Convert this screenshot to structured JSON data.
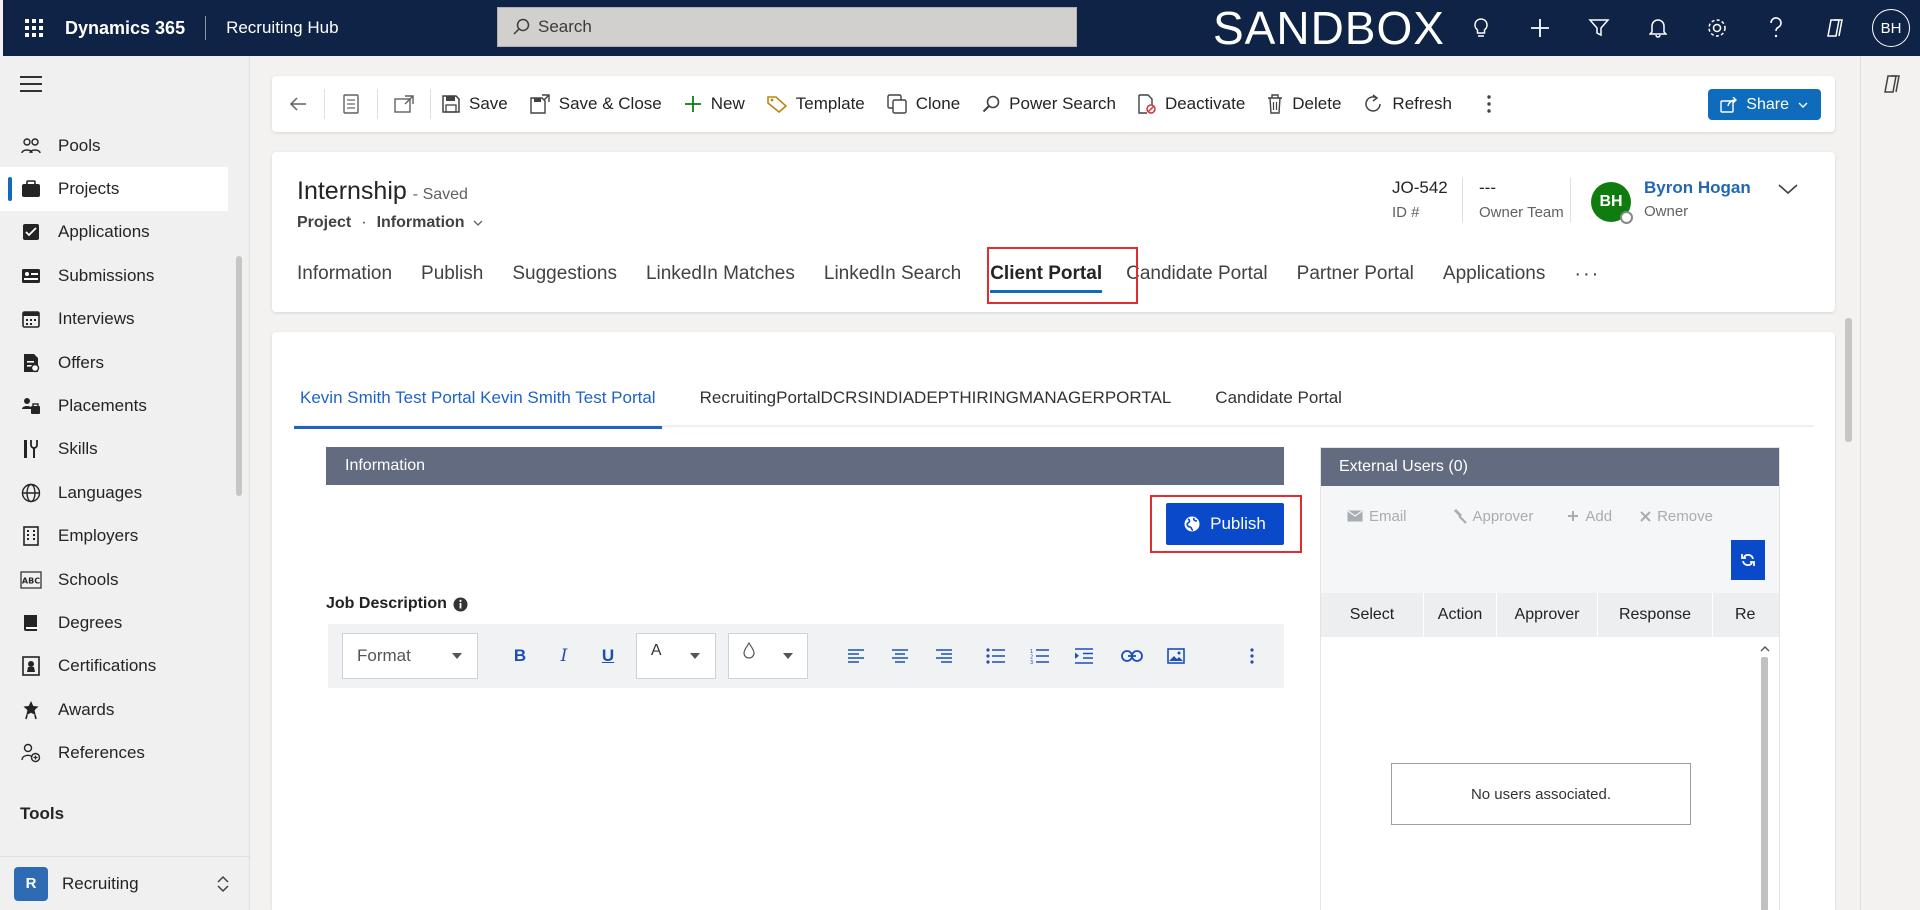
{
  "topbar": {
    "brand": "Dynamics 365",
    "app_name": "Recruiting Hub",
    "search_placeholder": "Search",
    "environment": "SANDBOX",
    "user_initials": "BH",
    "icons": [
      "lightbulb-icon",
      "plus-icon",
      "filter-icon",
      "bell-icon",
      "gear-icon",
      "help-icon",
      "copilot-icon"
    ]
  },
  "sidebar": {
    "items": [
      {
        "label": "Pools",
        "icon": "pools-icon"
      },
      {
        "label": "Projects",
        "icon": "briefcase-icon",
        "active": true
      },
      {
        "label": "Applications",
        "icon": "applications-icon"
      },
      {
        "label": "Submissions",
        "icon": "submissions-icon"
      },
      {
        "label": "Interviews",
        "icon": "calendar-icon"
      },
      {
        "label": "Offers",
        "icon": "offers-icon"
      },
      {
        "label": "Placements",
        "icon": "placements-icon"
      },
      {
        "label": "Skills",
        "icon": "skills-icon"
      },
      {
        "label": "Languages",
        "icon": "globe-icon"
      },
      {
        "label": "Employers",
        "icon": "building-icon"
      },
      {
        "label": "Schools",
        "icon": "abc-icon"
      },
      {
        "label": "Degrees",
        "icon": "book-icon"
      },
      {
        "label": "Certifications",
        "icon": "certificate-icon"
      },
      {
        "label": "Awards",
        "icon": "award-icon"
      },
      {
        "label": "References",
        "icon": "references-icon"
      }
    ],
    "tools_label": "Tools",
    "area_badge": "R",
    "area_name": "Recruiting"
  },
  "commandbar": {
    "save": "Save",
    "save_close": "Save & Close",
    "new": "New",
    "template": "Template",
    "clone": "Clone",
    "power_search": "Power Search",
    "deactivate": "Deactivate",
    "delete": "Delete",
    "refresh": "Refresh",
    "share": "Share"
  },
  "record": {
    "title": "Internship",
    "saved_status": "- Saved",
    "entity": "Project",
    "separator": "·",
    "form": "Information",
    "id_value": "JO-542",
    "id_label": "ID #",
    "owner_team_value": "---",
    "owner_team_label": "Owner Team",
    "owner_initials": "BH",
    "owner_name": "Byron Hogan",
    "owner_label": "Owner"
  },
  "tabs": [
    {
      "label": "Information"
    },
    {
      "label": "Publish"
    },
    {
      "label": "Suggestions"
    },
    {
      "label": "LinkedIn Matches"
    },
    {
      "label": "LinkedIn Search"
    },
    {
      "label": "Client Portal",
      "active": true
    },
    {
      "label": "Candidate Portal"
    },
    {
      "label": "Partner Portal"
    },
    {
      "label": "Applications"
    }
  ],
  "tabs_more": "···",
  "portal_tabs": [
    {
      "label": "Kevin Smith Test Portal Kevin Smith Test Portal",
      "active": true
    },
    {
      "label": "RecruitingPortalDCRSINDIADEPTHIRINGMANAGERPORTAL"
    },
    {
      "label": "Candidate Portal"
    }
  ],
  "information": {
    "section_title": "Information",
    "publish_label": "Publish",
    "job_description_label": "Job Description",
    "editor": {
      "format_label": "Format",
      "bold": "B",
      "italic": "I",
      "underline": "U",
      "font_color": "A"
    }
  },
  "external_users": {
    "title": "External Users (0)",
    "actions": {
      "email": "Email",
      "approver": "Approver",
      "add": "Add",
      "remove": "Remove"
    },
    "columns": [
      "Select",
      "Action",
      "Approver",
      "Response",
      "Re"
    ],
    "empty_message": "No users associated."
  },
  "colors": {
    "topbar_bg": "#0f2346",
    "accent": "#0f6cbd",
    "publish_btn": "#0a49c9",
    "section_header": "#636b80",
    "highlight_border": "#e02d2d",
    "owner_avatar": "#107c10"
  }
}
